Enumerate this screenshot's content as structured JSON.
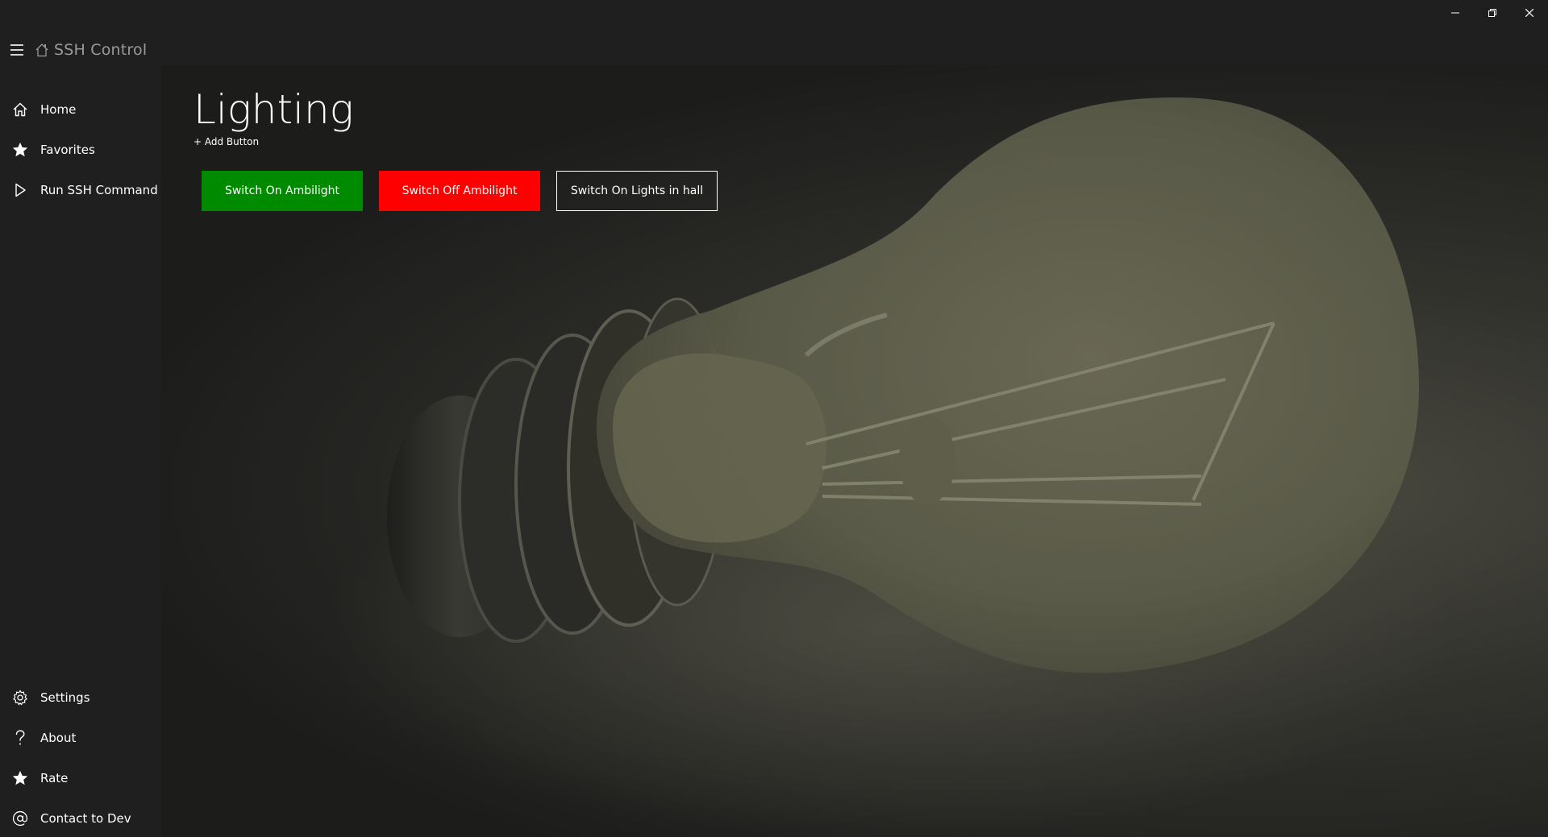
{
  "app": {
    "title": "SSH Control"
  },
  "sidebar": {
    "top_items": [
      {
        "label": "Home",
        "icon": "home-icon"
      },
      {
        "label": "Favorites",
        "icon": "star-icon"
      },
      {
        "label": "Run SSH Command",
        "icon": "play-icon"
      }
    ],
    "bottom_items": [
      {
        "label": "Settings",
        "icon": "gear-icon"
      },
      {
        "label": "About",
        "icon": "question-icon"
      },
      {
        "label": "Rate",
        "icon": "star-icon"
      },
      {
        "label": "Contact to Dev",
        "icon": "at-icon"
      }
    ]
  },
  "main": {
    "title": "Lighting",
    "add_button_label": "+ Add Button",
    "buttons": [
      {
        "label": "Switch On Ambilight",
        "color": "#008a00"
      },
      {
        "label": "Switch Off Ambilight",
        "color": "#ff0000"
      },
      {
        "label": "Switch On Lights in hall",
        "color": "transparent"
      }
    ]
  },
  "colors": {
    "background": "#1f1f1f",
    "accent_green": "#008a00",
    "accent_red": "#ff0000",
    "muted_text": "#9a9a9a"
  }
}
